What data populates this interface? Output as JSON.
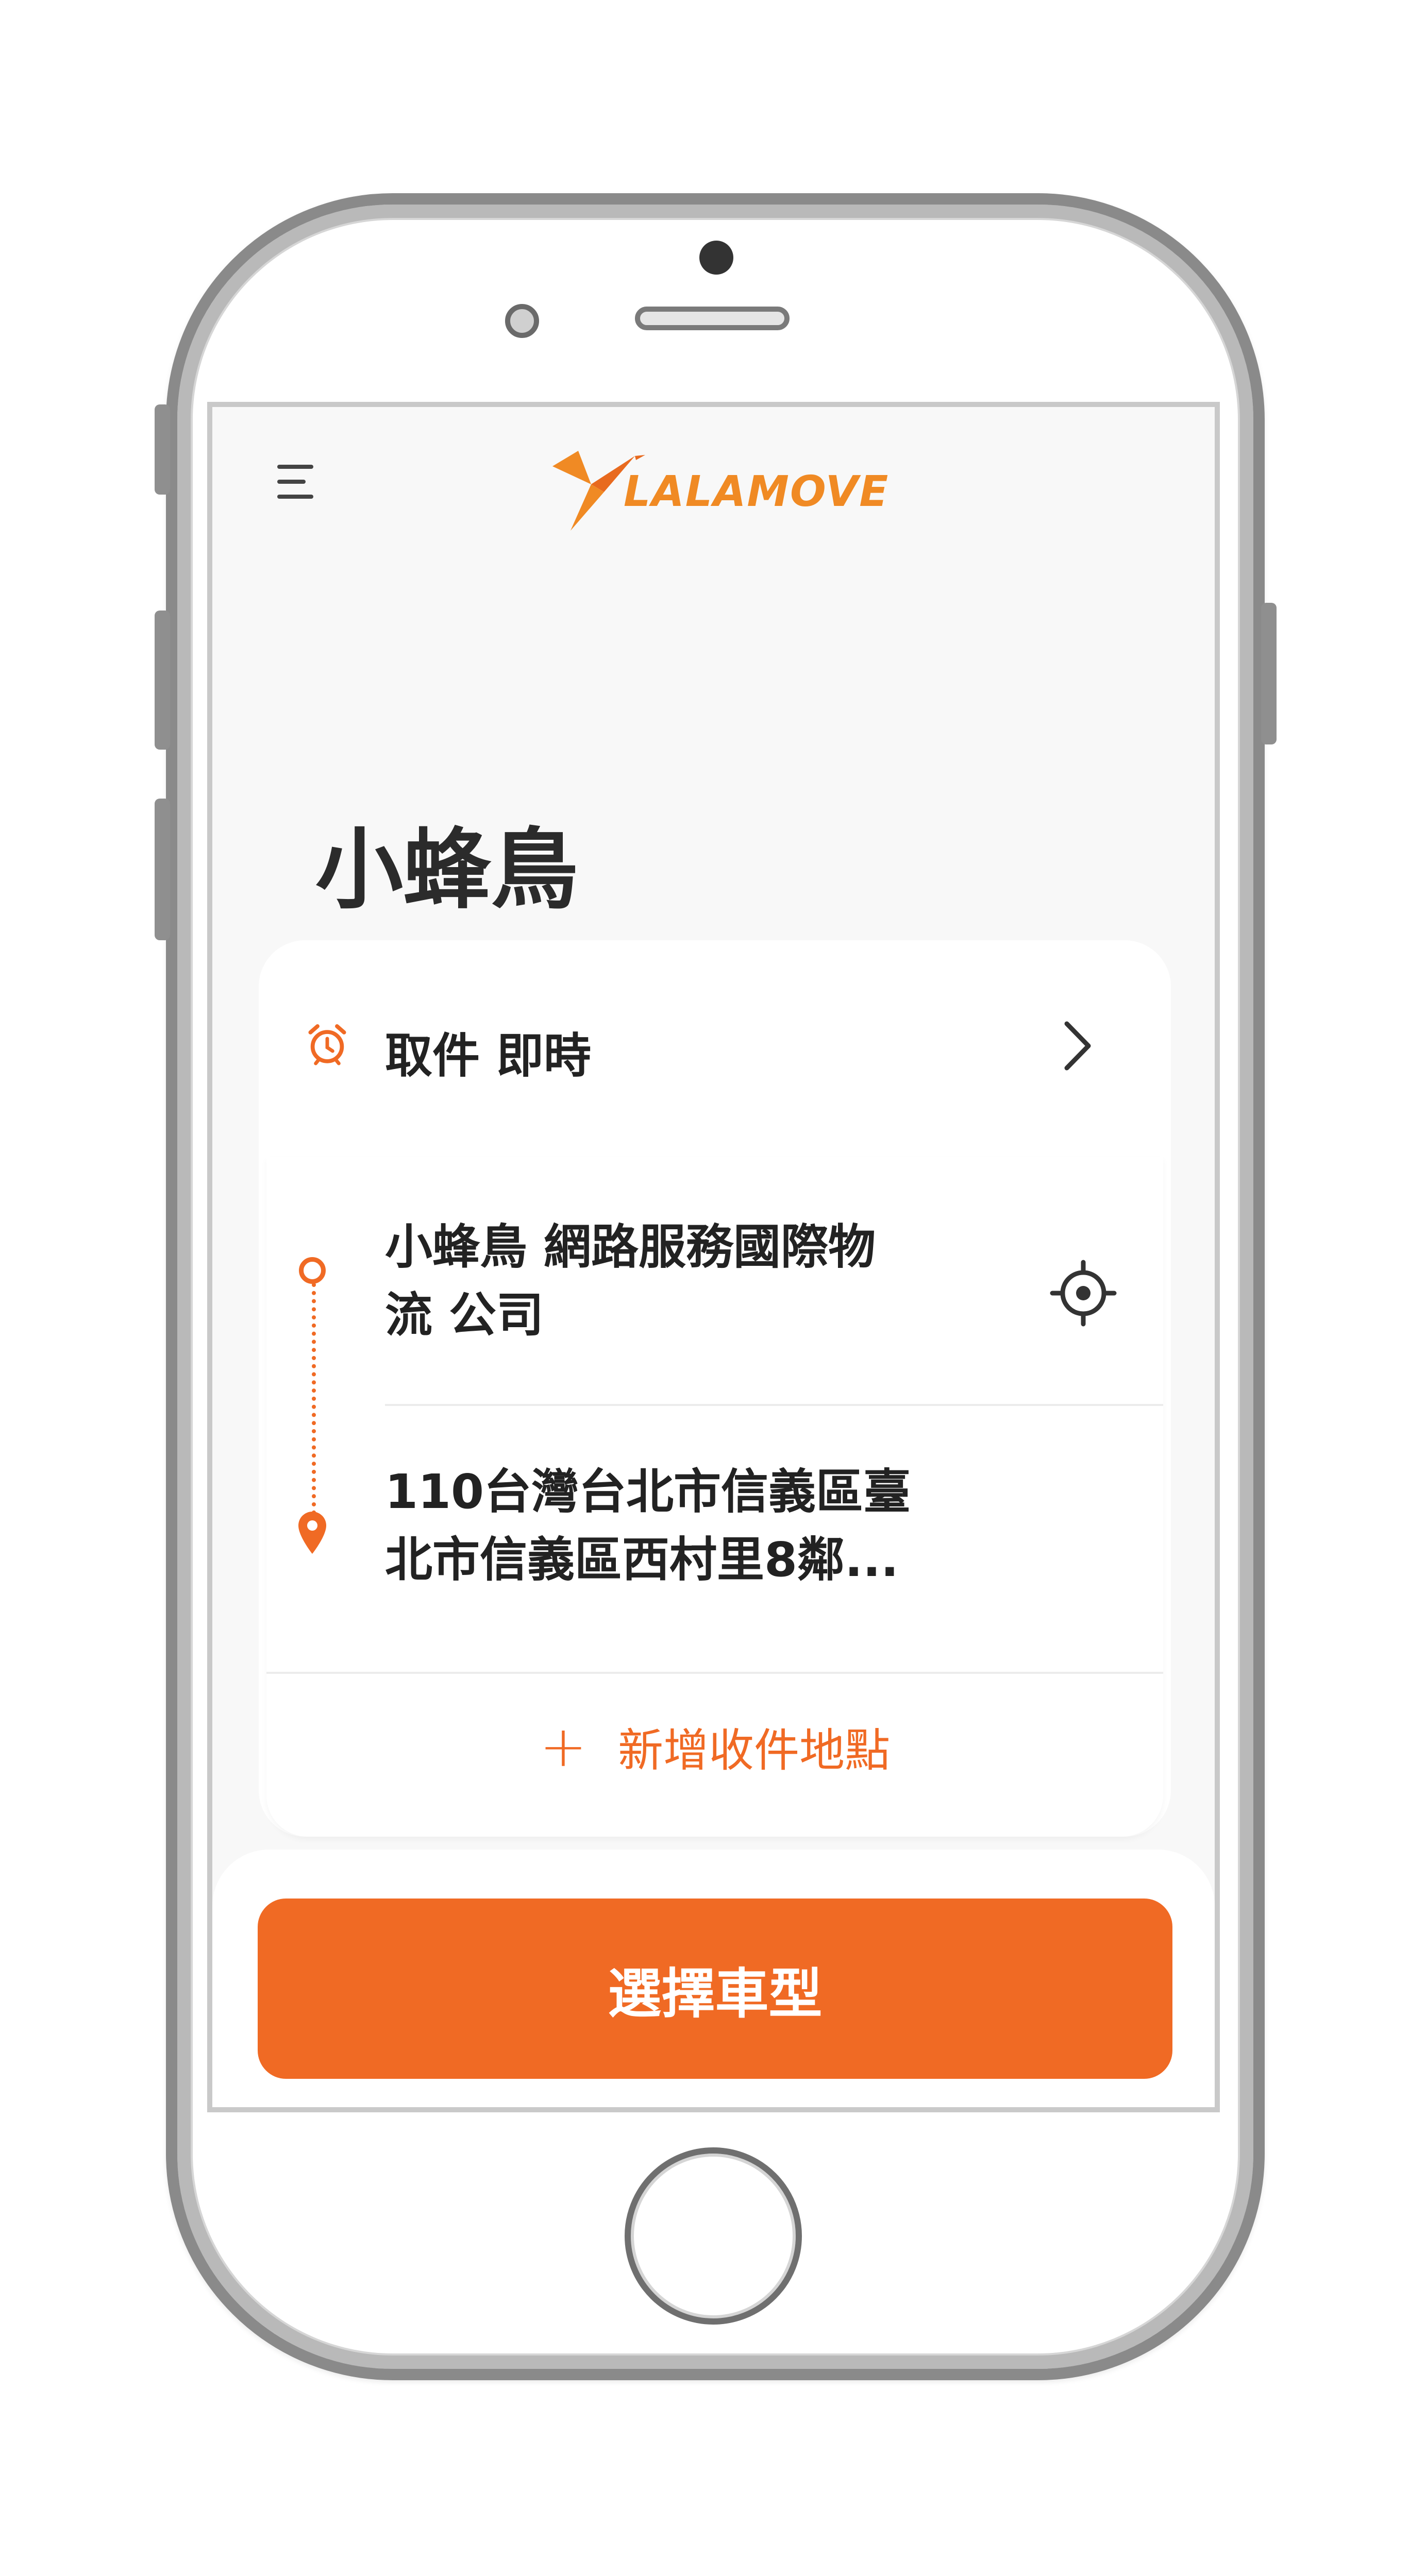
{
  "app": {
    "logo_text": "LALAMOVE"
  },
  "header": {
    "menu_icon": "hamburger-menu-icon"
  },
  "page": {
    "title": "小蜂鳥"
  },
  "pickup": {
    "label": "取件 即時",
    "icon": "alarm-clock-icon"
  },
  "route": {
    "stops": [
      {
        "text_line1": "小蜂鳥 網路服務國際物",
        "text_line2": "流 公司",
        "icon": "origin-circle-icon"
      },
      {
        "text_line1": "110台灣台北市信義區臺",
        "text_line2": "北市信義區西村里8鄰...",
        "icon": "destination-pin-icon"
      }
    ],
    "add_stop_label": "新增收件地點"
  },
  "footer": {
    "primary_button_label": "選擇車型"
  },
  "colors": {
    "accent": "#f06a24",
    "logo": "#f08a24"
  }
}
